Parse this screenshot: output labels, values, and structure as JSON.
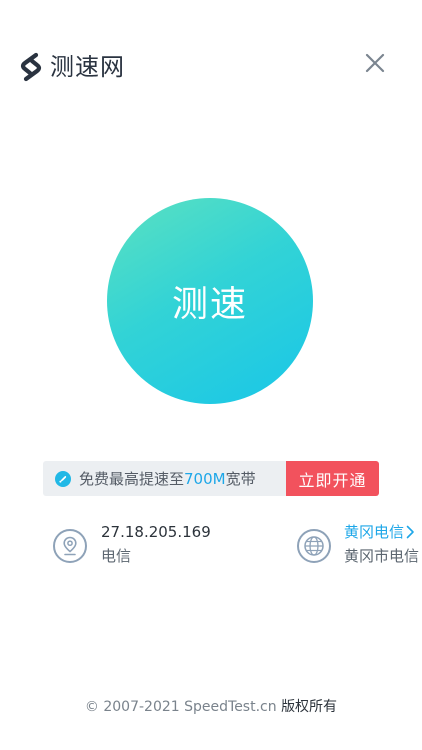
{
  "header": {
    "brand": "测速网",
    "logo_icon": "speedtest-s-logo-icon",
    "close_icon": "close-icon"
  },
  "speed_button": {
    "label": "测速",
    "gradient_start": "#5ce1c0",
    "gradient_end": "#19c6e8"
  },
  "promo": {
    "icon": "rocket-icon",
    "text_before": "免费最高提速至",
    "highlight": "700M",
    "text_after": "宽带",
    "button_label": "立即开通",
    "button_color": "#f2525d"
  },
  "ip_info": {
    "icon": "location-pin-icon",
    "ip": "27.18.205.169",
    "isp": "电信"
  },
  "server_info": {
    "icon": "globe-icon",
    "node": "黄冈电信",
    "node_detail": "黄冈市电信"
  },
  "footer": {
    "copyright": "© 2007-2021 SpeedTest.cn",
    "rights": "版权所有"
  }
}
